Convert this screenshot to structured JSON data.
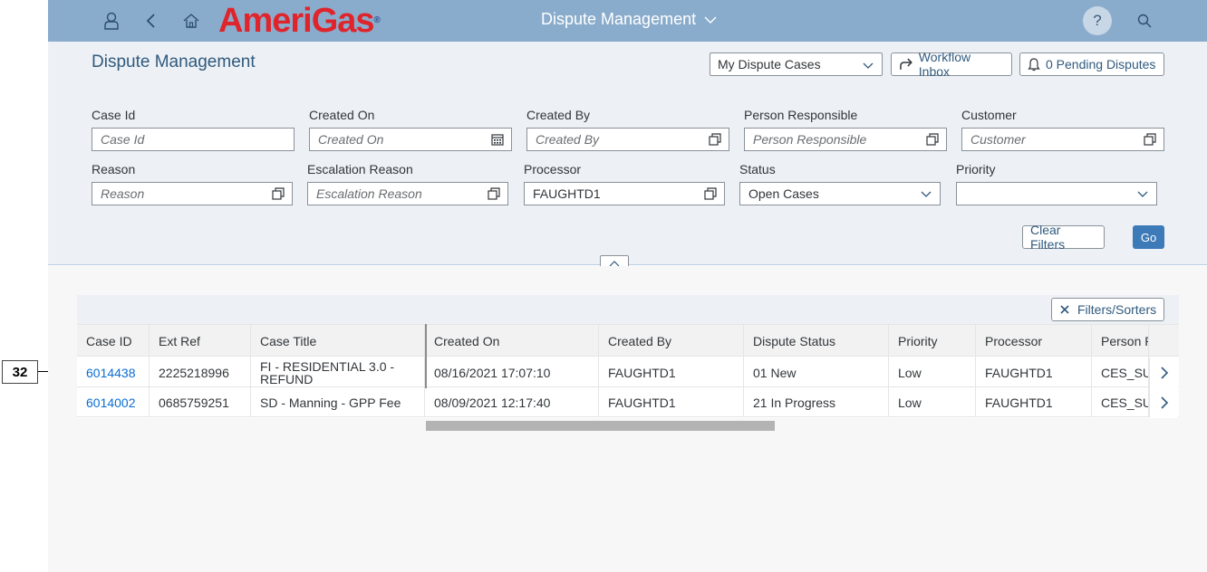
{
  "annotation": {
    "label": "32"
  },
  "shell": {
    "brand": "AmeriGas",
    "brand_reg": "®",
    "title": "Dispute Management",
    "help": "?"
  },
  "header": {
    "page_title": "Dispute Management",
    "variant": "My Dispute Cases",
    "workflow_inbox": "Workflow Inbox",
    "pending_disputes": "0 Pending Disputes"
  },
  "filters": {
    "case_id": {
      "label": "Case Id",
      "placeholder": "Case Id"
    },
    "created_on": {
      "label": "Created On",
      "placeholder": "Created On"
    },
    "created_by": {
      "label": "Created By",
      "placeholder": "Created By"
    },
    "person_responsible": {
      "label": "Person Responsible",
      "placeholder": "Person Responsible"
    },
    "customer": {
      "label": "Customer",
      "placeholder": "Customer"
    },
    "reason": {
      "label": "Reason",
      "placeholder": "Reason"
    },
    "escalation_reason": {
      "label": "Escalation Reason",
      "placeholder": "Escalation Reason"
    },
    "processor": {
      "label": "Processor",
      "value": "FAUGHTD1"
    },
    "status": {
      "label": "Status",
      "value": "Open Cases"
    },
    "priority": {
      "label": "Priority",
      "value": ""
    },
    "clear_filters": "Clear Filters",
    "go": "Go"
  },
  "table": {
    "filters_sorters": "Filters/Sorters",
    "columns": [
      "Case ID",
      "Ext Ref",
      "Case Title",
      "Created On",
      "Created By",
      "Dispute Status",
      "Priority",
      "Processor",
      "Person R"
    ],
    "rows": [
      [
        "6014438",
        "2225218996",
        "FI - RESIDENTIAL 3.0 - REFUND",
        "08/16/2021 17:07:10",
        "FAUGHTD1",
        "01 New",
        "Low",
        "FAUGHTD1",
        "CES_SU"
      ],
      [
        "6014002",
        "0685759251",
        "SD - Manning - GPP Fee",
        "08/09/2021 12:17:40",
        "FAUGHTD1",
        "21 In Progress",
        "Low",
        "FAUGHTD1",
        "CES_SU"
      ]
    ]
  },
  "colors": {
    "shell_bg": "#8aaccc",
    "brand_red": "#e0242b",
    "link_blue": "#0a6ed1",
    "go_button": "#3c7ab8"
  }
}
